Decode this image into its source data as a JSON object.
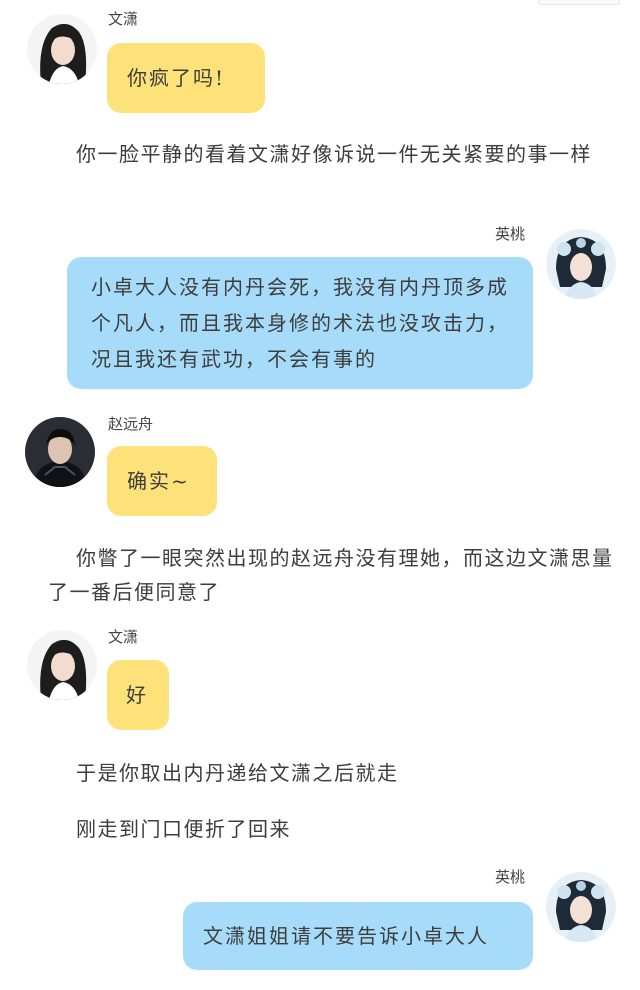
{
  "messages": [
    {
      "speaker": "文潇",
      "text": "你疯了吗!"
    },
    {
      "speaker": "英桃",
      "text": "小卓大人没有内丹会死，我没有内丹顶多成个凡人，而且我本身修的术法也没攻击力，况且我还有武功，不会有事的"
    },
    {
      "speaker": "赵远舟",
      "text": "确实~"
    },
    {
      "speaker": "文潇",
      "text": "好"
    },
    {
      "speaker": "英桃",
      "text": "文潇姐姐请不要告诉小卓大人"
    }
  ],
  "narrations": [
    "你一脸平静的看着文潇好像诉说一件无关紧要的事一样",
    "你瞥了一眼突然出现的赵远舟没有理她，而这边文潇思量了一番后便同意了",
    "于是你取出内丹递给文潇之后就走",
    "刚走到门口便折了回来"
  ],
  "colors": {
    "left_bubble": "#fde27a",
    "right_bubble": "#a6dbfa",
    "background": "#ffffff"
  }
}
